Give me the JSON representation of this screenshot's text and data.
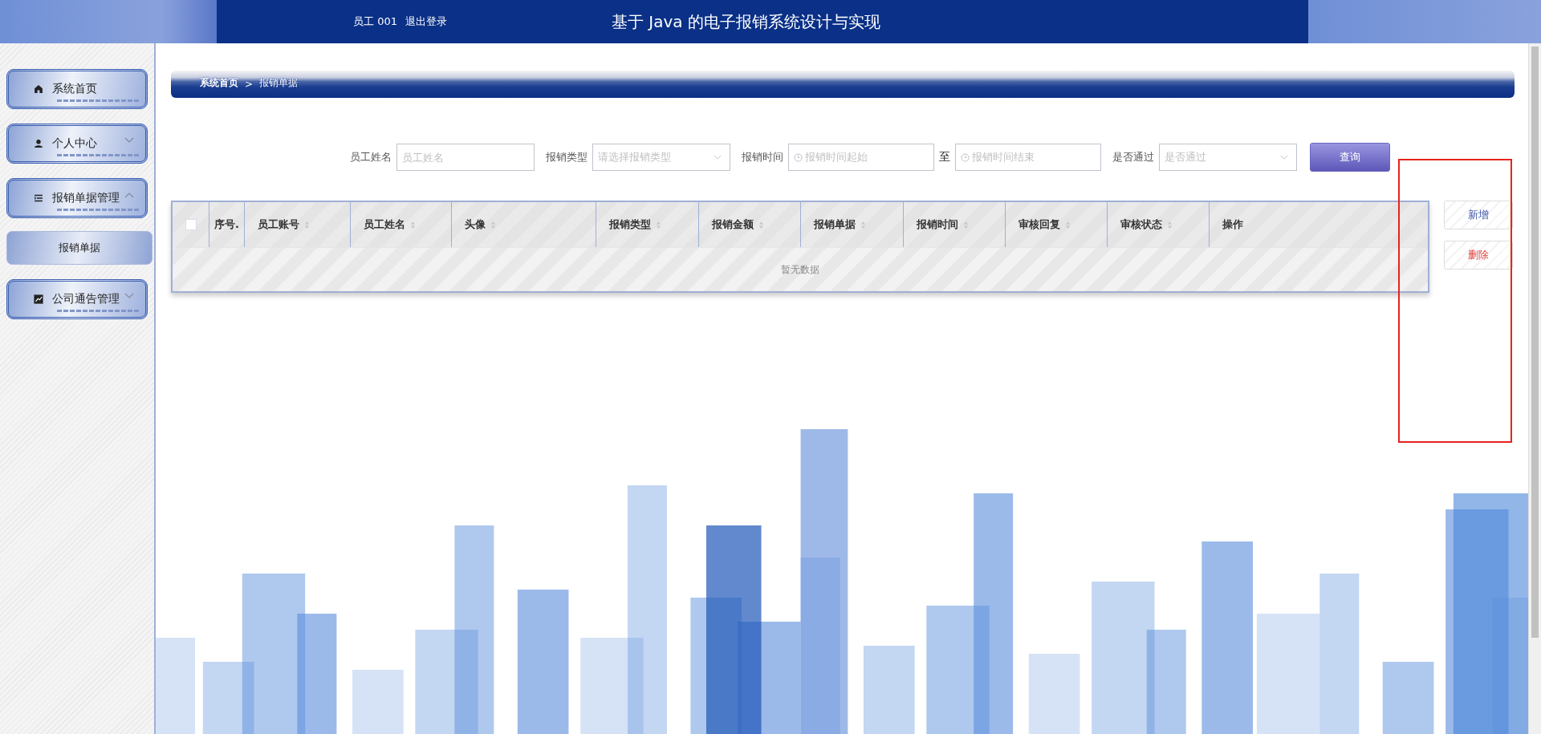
{
  "header": {
    "user_label": "员工 001",
    "logout": "退出登录",
    "title": "基于 Java 的电子报销系统设计与实现"
  },
  "sidebar": {
    "items": [
      {
        "label": "系统首页",
        "selected": false
      },
      {
        "label": "个人中心",
        "selected": false,
        "expanded": false
      },
      {
        "label": "报销单据管理",
        "selected": false,
        "expanded": true,
        "children": [
          {
            "label": "报销单据",
            "selected": true
          }
        ]
      },
      {
        "label": "公司通告管理",
        "selected": false,
        "expanded": false
      }
    ]
  },
  "breadcrumb": {
    "items": [
      "系统首页",
      "报销单据"
    ],
    "separator": ">"
  },
  "search": {
    "fields": [
      {
        "kind": "input",
        "label": "员工姓名",
        "placeholder": "员工姓名"
      },
      {
        "kind": "select",
        "label": "报销类型",
        "placeholder": "请选择报销类型"
      },
      {
        "kind": "daterange",
        "label": "报销时间",
        "placeholder": "报销时间起始",
        "separator": "至",
        "placeholder_end": "报销时间结束"
      },
      {
        "kind": "select",
        "label": "是否通过",
        "placeholder": "是否通过"
      }
    ],
    "button": "查询"
  },
  "table": {
    "select_all_checked": false,
    "columns": [
      {
        "label": "序号.",
        "sortable": false
      },
      {
        "label": "员工账号",
        "sortable": true
      },
      {
        "label": "员工姓名",
        "sortable": true
      },
      {
        "label": "头像",
        "sortable": true
      },
      {
        "label": "报销类型",
        "sortable": true
      },
      {
        "label": "报销金额",
        "sortable": true
      },
      {
        "label": "报销单据",
        "sortable": true
      },
      {
        "label": "报销时间",
        "sortable": true
      },
      {
        "label": "审核回复",
        "sortable": true
      },
      {
        "label": "审核状态",
        "sortable": true
      },
      {
        "label": "操作",
        "sortable": false
      }
    ],
    "empty_text": "暂无数据"
  },
  "actions": [
    {
      "label": "新增",
      "kind": "add"
    },
    {
      "label": "删除",
      "kind": "delete"
    }
  ]
}
